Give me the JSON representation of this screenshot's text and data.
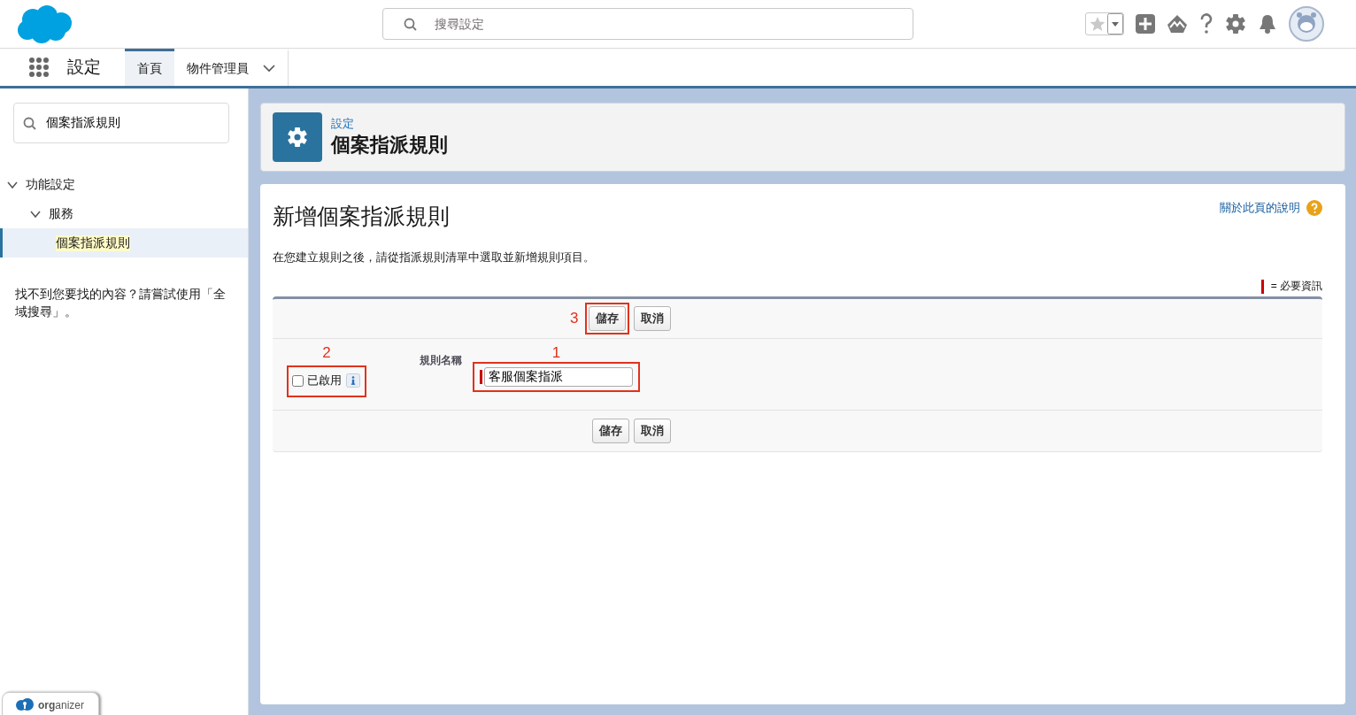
{
  "global_header": {
    "search": {
      "placeholder": "搜尋設定"
    }
  },
  "nav": {
    "app_name": "設定",
    "tabs": [
      {
        "label": "首頁",
        "selected": true,
        "has_menu": false
      },
      {
        "label": "物件管理員",
        "selected": false,
        "has_menu": true
      }
    ]
  },
  "sidebar": {
    "search": {
      "value": "個案指派規則"
    },
    "tree": [
      {
        "label": "功能設定",
        "expanded": true,
        "selected": false,
        "children": [
          {
            "label": "服務",
            "expanded": true,
            "selected": false,
            "children": [
              {
                "label": "個案指派規則",
                "selected": true
              }
            ]
          }
        ]
      }
    ],
    "help_text": "找不到您要找的內容？請嘗試使用「全域搜尋」。"
  },
  "organizer": "**org**anizer",
  "page_header": {
    "breadcrumb": "設定",
    "title": "個案指派規則"
  },
  "form": {
    "title": "新增個案指派規則",
    "help_link": "關於此頁的說明",
    "intro": "在您建立規則之後，請從指派規則清單中選取並新增規則項目。",
    "required_legend": "= 必要資訊",
    "top_buttons": [
      {
        "label": "儲存",
        "callout": "3"
      },
      {
        "label": "取消"
      }
    ],
    "field": {
      "label": "規則名稱",
      "value": "客服個案指派",
      "required": true,
      "callout": "1"
    },
    "active": {
      "label": "已啟用",
      "checked": false,
      "callout": "2"
    },
    "bottom_buttons": [
      {
        "label": "儲存"
      },
      {
        "label": "取消"
      }
    ]
  }
}
